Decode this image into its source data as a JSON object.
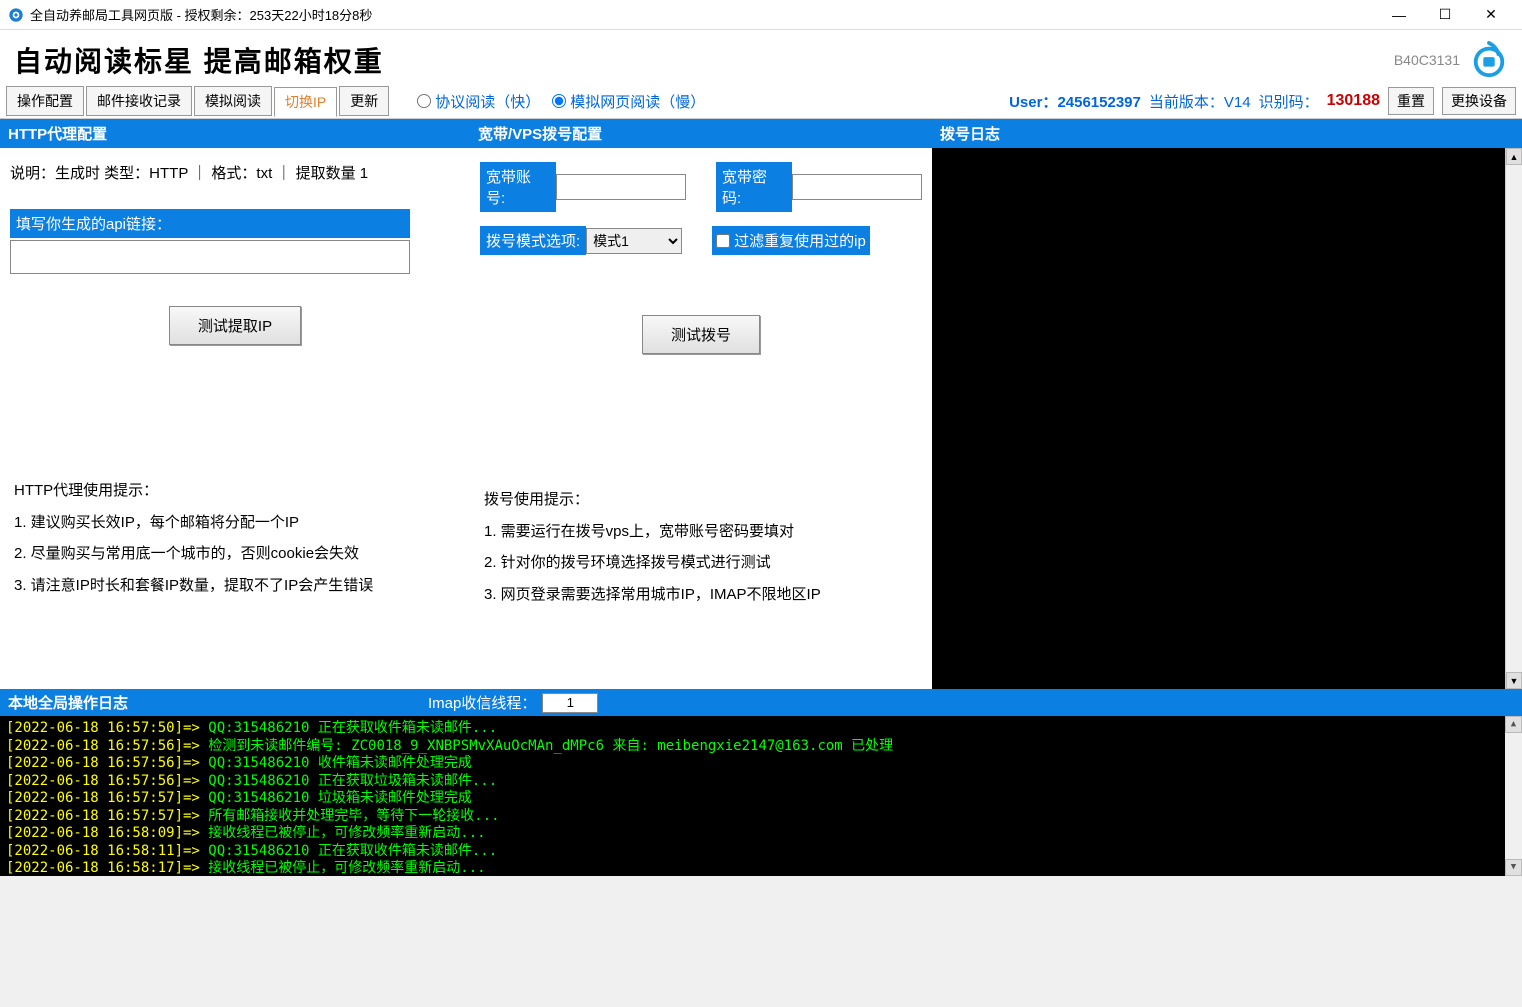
{
  "window": {
    "title": "全自动养邮局工具网页版 - 授权剩余：253天22小时18分8秒"
  },
  "header": {
    "slogan": "自动阅读标星 提高邮箱权重",
    "code": "B40C3131"
  },
  "tabs": [
    "操作配置",
    "邮件接收记录",
    "模拟阅读",
    "切换IP",
    "更新"
  ],
  "activeTabIndex": 3,
  "radios": {
    "opt1": "协议阅读（快）",
    "opt2": "模拟网页阅读（慢）",
    "selected": 1
  },
  "status": {
    "userLabel": "User：",
    "userValue": "2456152397",
    "versionLabel": "当前版本：",
    "versionValue": "V14",
    "idLabel": "识别码：",
    "idValue": "130188",
    "resetBtn": "重置",
    "changeDeviceBtn": "更换设备"
  },
  "httpProxy": {
    "header": "HTTP代理配置",
    "desc": "说明：生成时 类型：HTTP ｜ 格式：txt  ｜ 提取数量 1",
    "apiLabel": "填写你生成的api链接：",
    "apiValue": "",
    "testBtn": "测试提取IP",
    "tipsTitle": "HTTP代理使用提示：",
    "tips": [
      "1. 建议购买长效IP，每个邮箱将分配一个IP",
      "2. 尽量购买与常用底一个城市的，否则cookie会失效",
      "3. 请注意IP时长和套餐IP数量，提取不了IP会产生错误"
    ]
  },
  "dialup": {
    "header": "宽带/VPS拨号配置",
    "accountLabel": "宽带账号:",
    "accountValue": "",
    "passwordLabel": "宽带密码:",
    "passwordValue": "",
    "modeLabel": "拨号模式选项:",
    "modeSelected": "模式1",
    "filterLabel": "过滤重复使用过的ip",
    "testBtn": "测试拨号",
    "tipsTitle": "拨号使用提示：",
    "tips": [
      "1. 需要运行在拨号vps上，宽带账号密码要填对",
      "2. 针对你的拨号环境选择拨号模式进行测试",
      "3. 网页登录需要选择常用城市IP，IMAP不限地区IP"
    ]
  },
  "dialLog": {
    "header": "拨号日志"
  },
  "bottomLog": {
    "header": "本地全局操作日志",
    "threadLabel": "Imap收信线程：",
    "threadValue": "1",
    "lines": [
      {
        "ts": "[2022-06-18 16:57:50]=>",
        "msg": " QQ:315486210 正在获取收件箱未读邮件..."
      },
      {
        "ts": "[2022-06-18 16:57:56]=>",
        "msg": " 检测到未读邮件编号: ZC0018_9_XNBPSMvXAuOcMAn_dMPc6 来自: meibengxie2147@163.com 已处理"
      },
      {
        "ts": "[2022-06-18 16:57:56]=>",
        "msg": " QQ:315486210 收件箱未读邮件处理完成"
      },
      {
        "ts": "[2022-06-18 16:57:56]=>",
        "msg": " QQ:315486210 正在获取垃圾箱未读邮件..."
      },
      {
        "ts": "[2022-06-18 16:57:57]=>",
        "msg": " QQ:315486210 垃圾箱未读邮件处理完成"
      },
      {
        "ts": "[2022-06-18 16:57:57]=>",
        "msg": " 所有邮箱接收并处理完毕，等待下一轮接收..."
      },
      {
        "ts": "[2022-06-18 16:58:09]=>",
        "msg": " 接收线程已被停止，可修改频率重新启动..."
      },
      {
        "ts": "[2022-06-18 16:58:11]=>",
        "msg": " QQ:315486210 正在获取收件箱未读邮件..."
      },
      {
        "ts": "[2022-06-18 16:58:17]=>",
        "msg": " 接收线程已被停止，可修改频率重新启动..."
      }
    ]
  }
}
